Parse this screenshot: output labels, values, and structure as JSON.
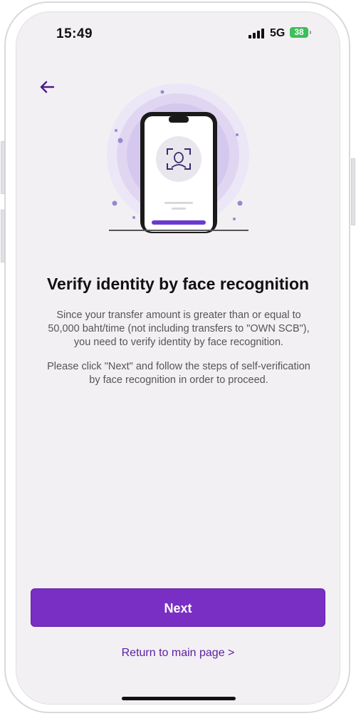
{
  "status_bar": {
    "time": "15:49",
    "network": "5G",
    "battery": "38"
  },
  "nav": {
    "back_icon": "arrow-left-icon"
  },
  "illustration": {
    "icon": "face-recognition-phone-illustration"
  },
  "content": {
    "title": "Verify identity by face recognition",
    "paragraph1_line1": "Since your transfer amount is greater than or equal to",
    "paragraph1_line2": "50,000 baht/time (not including transfers to \"OWN SCB\"),",
    "paragraph1_line3": "you need to verify identity by face recognition.",
    "paragraph2_line1": "Please click \"Next\" and follow the steps of self-verification",
    "paragraph2_line2": "by face recognition in order to proceed."
  },
  "actions": {
    "next_label": "Next",
    "return_label": "Return to main page >"
  },
  "colors": {
    "accent": "#7a2fc4",
    "link": "#5a1ea0",
    "background": "#f3f0f4"
  }
}
